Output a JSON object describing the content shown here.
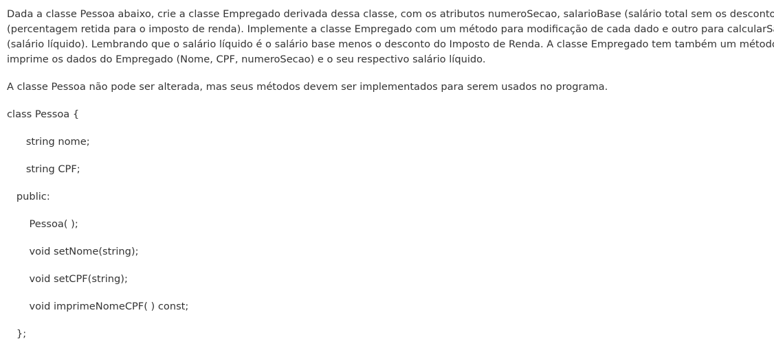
{
  "question": {
    "paragraph1_lines": [
      "Dada a classe Pessoa abaixo, crie a classe Empregado derivada dessa classe, com os atributos numeroSecao, salarioBase (salário total sem os descontos) e IR",
      "(percentagem retida para o imposto de renda). Implemente a classe Empregado com um método para modificação de cada dado e outro para calcularSalario",
      "(salário líquido). Lembrando que o salário líquido é o salário base menos o desconto do Imposto de Renda. A classe Empregado tem também um método que",
      "imprime os dados do Empregado (Nome, CPF, numeroSecao) e o seu respectivo salário líquido."
    ],
    "paragraph2": "A classe Pessoa não pode ser alterada, mas seus métodos devem ser implementados para serem usados no programa.",
    "code_lines": [
      "class Pessoa {",
      "      string nome;",
      "      string CPF;",
      "   public:",
      "       Pessoa( );",
      "       void setNome(string);",
      "       void setCPF(string);",
      "       void imprimeNomeCPF( ) const;",
      "   };"
    ]
  }
}
